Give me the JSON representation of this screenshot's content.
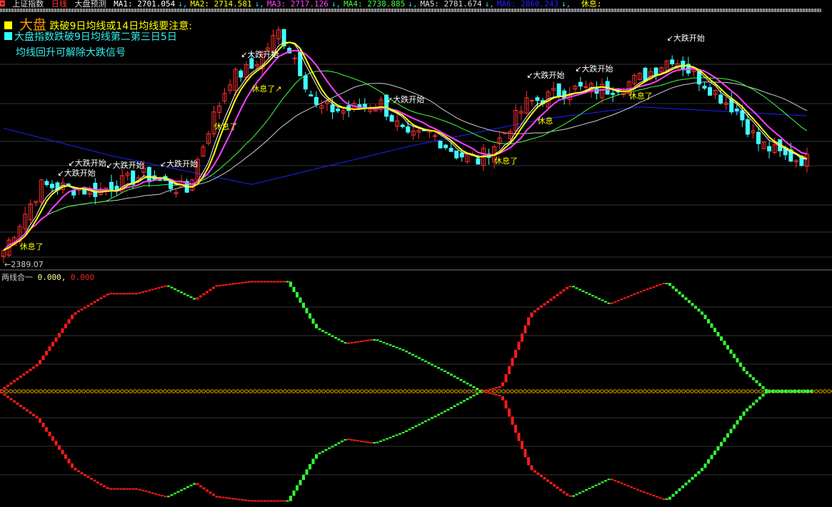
{
  "header": {
    "symbol": "上证指数",
    "period": "日线",
    "indicator": "大盘预测",
    "ma": [
      {
        "label": "MA1:",
        "value": "2701.054",
        "color": "#ffffff"
      },
      {
        "label": "MA2:",
        "value": "2714.581",
        "color": "#ffff00"
      },
      {
        "label": "MA3:",
        "value": "2717.126",
        "color": "#ff40ff"
      },
      {
        "label": "MA4:",
        "value": "2738.885",
        "color": "#40ff40"
      },
      {
        "label": "MA5:",
        "value": "2781.674",
        "color": "#dddddd"
      },
      {
        "label": "MA6:",
        "value": "2860.243",
        "color": "#2020ff"
      }
    ],
    "arrow": "↓",
    "rest": "休息:"
  },
  "notes": {
    "line1_big": "大盘",
    "line1": "跌破9日均线或14日均线要注意:",
    "line2": "大盘指数跌破9日均线第二第三日5日",
    "line3": "均线回升可解除大跌信号"
  },
  "low_label": "2389.07",
  "sub": {
    "title": "两线合一",
    "v1": "0.000,",
    "v2": "0.000"
  },
  "annotations": [
    {
      "text": "↙大跌开始",
      "type": "drop",
      "i": 12
    },
    {
      "text": "↙大跌开始",
      "type": "drop",
      "i": 10
    },
    {
      "text": "↙大跌开始",
      "type": "drop",
      "i": 19
    },
    {
      "text": "↙大跌开始",
      "type": "drop",
      "i": 29
    },
    {
      "text": "↙大跌开始",
      "type": "drop",
      "i": 44
    },
    {
      "text": "↙大跌开始",
      "type": "drop",
      "i": 71
    },
    {
      "text": "↙大跌开始",
      "type": "drop",
      "i": 97
    },
    {
      "text": "↙大跌开始",
      "type": "drop",
      "i": 106
    },
    {
      "text": "↙大跌开始",
      "type": "drop",
      "i": 123
    },
    {
      "text": "休息了",
      "type": "rest",
      "i": 3
    },
    {
      "text": "休息了",
      "type": "rest",
      "i": 39
    },
    {
      "text": "休息了↗",
      "type": "rest",
      "i": 46
    },
    {
      "text": "休息了",
      "type": "rest",
      "i": 91
    },
    {
      "text": "休息",
      "type": "rest",
      "i": 99
    },
    {
      "text": "休息了",
      "type": "rest",
      "i": 116
    }
  ],
  "chart_data": [
    {
      "type": "candlestick",
      "title": "上证指数 日线",
      "ylim": [
        2380,
        3180
      ],
      "n": 150,
      "close_keypoints": [
        [
          0,
          2431
        ],
        [
          7,
          2642
        ],
        [
          11,
          2637
        ],
        [
          17,
          2623
        ],
        [
          26,
          2677
        ],
        [
          34,
          2623
        ],
        [
          38,
          2829
        ],
        [
          42,
          2993
        ],
        [
          46,
          3028
        ],
        [
          51,
          3145
        ],
        [
          54,
          3063
        ],
        [
          58,
          2899
        ],
        [
          63,
          2888
        ],
        [
          70,
          2911
        ],
        [
          75,
          2794
        ],
        [
          79,
          2817
        ],
        [
          84,
          2747
        ],
        [
          88,
          2724
        ],
        [
          92,
          2794
        ],
        [
          97,
          2911
        ],
        [
          105,
          2958
        ],
        [
          112,
          2958
        ],
        [
          118,
          2993
        ],
        [
          124,
          3063
        ],
        [
          129,
          2993
        ],
        [
          136,
          2888
        ],
        [
          140,
          2782
        ],
        [
          145,
          2736
        ],
        [
          150,
          2724
        ]
      ],
      "ma6_keypoints": [
        [
          0,
          2830
        ],
        [
          20,
          2740
        ],
        [
          46,
          2646
        ],
        [
          75,
          2770
        ],
        [
          100,
          2860
        ],
        [
          118,
          2900
        ],
        [
          150,
          2870
        ]
      ],
      "colors": {
        "up": "#ff3030",
        "down": "#40ffff",
        "ma1": "#ffffff",
        "ma2": "#ffff00",
        "ma3": "#ff40ff",
        "ma4": "#40ff40",
        "ma5": "#cccccc",
        "ma6": "#2020ff"
      }
    },
    {
      "type": "line",
      "title": "两线合一",
      "ylim": [
        -105,
        105
      ],
      "upper_keypoints": [
        [
          0,
          2
        ],
        [
          50,
          25
        ],
        [
          100,
          71
        ],
        [
          150,
          90
        ],
        [
          190,
          90
        ],
        [
          230,
          97
        ],
        [
          270,
          84
        ],
        [
          300,
          97
        ],
        [
          350,
          101
        ],
        [
          400,
          101
        ],
        [
          440,
          58
        ],
        [
          480,
          44
        ],
        [
          520,
          48
        ],
        [
          560,
          38
        ],
        [
          620,
          18
        ],
        [
          670,
          0
        ],
        [
          700,
          5
        ],
        [
          740,
          71
        ],
        [
          795,
          97
        ],
        [
          850,
          80
        ],
        [
          900,
          93
        ],
        [
          930,
          100
        ],
        [
          980,
          71
        ],
        [
          1040,
          18
        ],
        [
          1070,
          0
        ],
        [
          1135,
          0
        ]
      ],
      "colors": {
        "rise": "#ff1a1a",
        "fall": "#33ff33",
        "zero": "#e0a000"
      }
    }
  ]
}
